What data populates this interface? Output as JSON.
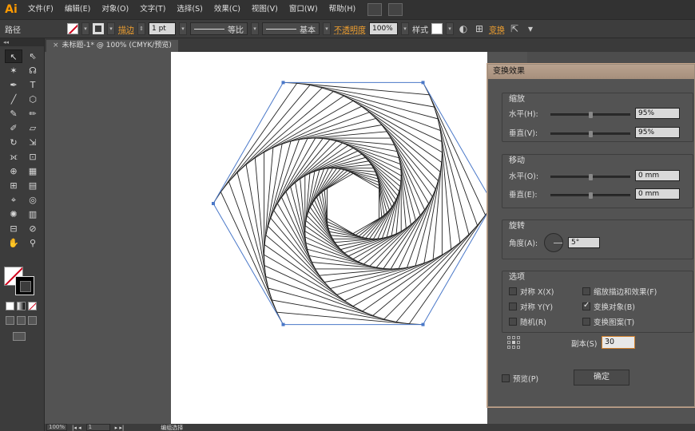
{
  "app": {
    "logo": "Ai"
  },
  "menu": [
    "文件(F)",
    "编辑(E)",
    "对象(O)",
    "文字(T)",
    "选择(S)",
    "效果(C)",
    "视图(V)",
    "窗口(W)",
    "帮助(H)"
  ],
  "control": {
    "object_type": "路径",
    "stroke_label": "描边",
    "stroke_weight": "1 pt",
    "profile_label": "等比",
    "brush_label": "基本",
    "opacity_label": "不透明度",
    "opacity_value": "100%",
    "style_label": "样式",
    "transform_label": "变换"
  },
  "document": {
    "tab_title": "未标题-1* @ 100% (CMYK/预览)",
    "close": "×"
  },
  "dialog": {
    "title": "变换效果",
    "scale": {
      "title": "缩放",
      "h_label": "水平(H):",
      "h_value": "95%",
      "v_label": "垂直(V):",
      "v_value": "95%",
      "h_level": 0.5,
      "v_level": 0.5
    },
    "move": {
      "title": "移动",
      "h_label": "水平(O):",
      "h_value": "0 mm",
      "v_label": "垂直(E):",
      "v_value": "0 mm",
      "h_level": 0.5,
      "v_level": 0.5
    },
    "rotate": {
      "title": "旋转",
      "angle_label": "角度(A):",
      "angle_value": "5°"
    },
    "options": {
      "title": "选项",
      "reflect_x": "对称 X(X)",
      "reflect_y": "对称 Y(Y)",
      "random": "随机(R)",
      "scale_strokes": "缩放描边和效果(F)",
      "transform_objects": "变换对象(B)",
      "transform_patterns": "变换图案(T)",
      "transform_objects_checked": true
    },
    "copies_label": "副本(S)",
    "copies_value": "30",
    "preview_label": "预览(P)",
    "ok_label": "确定"
  },
  "status": {
    "zoom": "100%",
    "page": "1",
    "tool": "编组选择"
  },
  "colors": {
    "accent": "#f0a030",
    "selection": "#4a78c8"
  }
}
